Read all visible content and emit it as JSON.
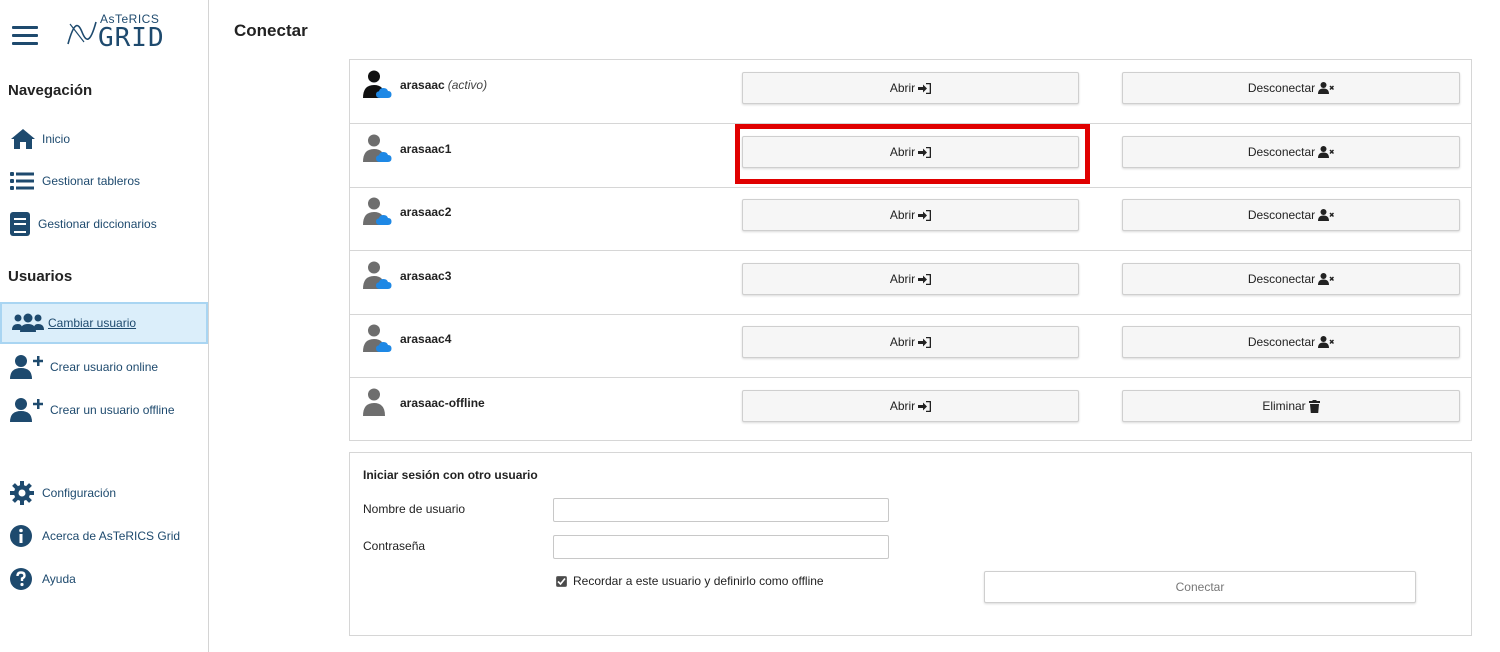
{
  "logo": {
    "top_text": "AsTeRICS",
    "main_text": "GRID"
  },
  "sidebar": {
    "nav_heading": "Navegación",
    "nav_items": [
      {
        "label": "Inicio",
        "icon": "home-icon"
      },
      {
        "label": "Gestionar tableros",
        "icon": "list-icon"
      },
      {
        "label": "Gestionar diccionarios",
        "icon": "book-icon"
      }
    ],
    "users_heading": "Usuarios",
    "user_items": [
      {
        "label": "Cambiar usuario",
        "icon": "users-icon",
        "active": true
      },
      {
        "label": "Crear usuario online",
        "icon": "user-plus-icon"
      },
      {
        "label": "Crear un usuario offline",
        "icon": "user-plus-icon"
      }
    ],
    "footer_items": [
      {
        "label": "Configuración",
        "icon": "gear-icon"
      },
      {
        "label": "Acerca de AsTeRICS Grid",
        "icon": "info-icon"
      },
      {
        "label": "Ayuda",
        "icon": "question-icon"
      }
    ]
  },
  "main": {
    "title": "Conectar",
    "users": [
      {
        "name": "arasaac",
        "status": "(activo)",
        "open_label": "Abrir",
        "second_label": "Desconectar",
        "second_icon": "user-remove-icon",
        "online": true
      },
      {
        "name": "arasaac1",
        "status": "",
        "open_label": "Abrir",
        "second_label": "Desconectar",
        "second_icon": "user-remove-icon",
        "online": true
      },
      {
        "name": "arasaac2",
        "status": "",
        "open_label": "Abrir",
        "second_label": "Desconectar",
        "second_icon": "user-remove-icon",
        "online": true
      },
      {
        "name": "arasaac3",
        "status": "",
        "open_label": "Abrir",
        "second_label": "Desconectar",
        "second_icon": "user-remove-icon",
        "online": true
      },
      {
        "name": "arasaac4",
        "status": "",
        "open_label": "Abrir",
        "second_label": "Desconectar",
        "second_icon": "user-remove-icon",
        "online": true
      },
      {
        "name": "arasaac-offline",
        "status": "",
        "open_label": "Abrir",
        "second_label": "Eliminar",
        "second_icon": "trash-icon",
        "online": false
      }
    ],
    "login": {
      "title": "Iniciar sesión con otro usuario",
      "username_label": "Nombre de usuario",
      "username_value": "",
      "password_label": "Contraseña",
      "password_value": "",
      "remember_label": "Recordar a este usuario y definirlo como offline",
      "remember_checked": true,
      "connect_label": "Conectar"
    }
  },
  "colors": {
    "accent": "#1e4a6e",
    "cloud": "#1e88e5",
    "highlight": "#e00000",
    "active_bg": "#dbeefa"
  }
}
